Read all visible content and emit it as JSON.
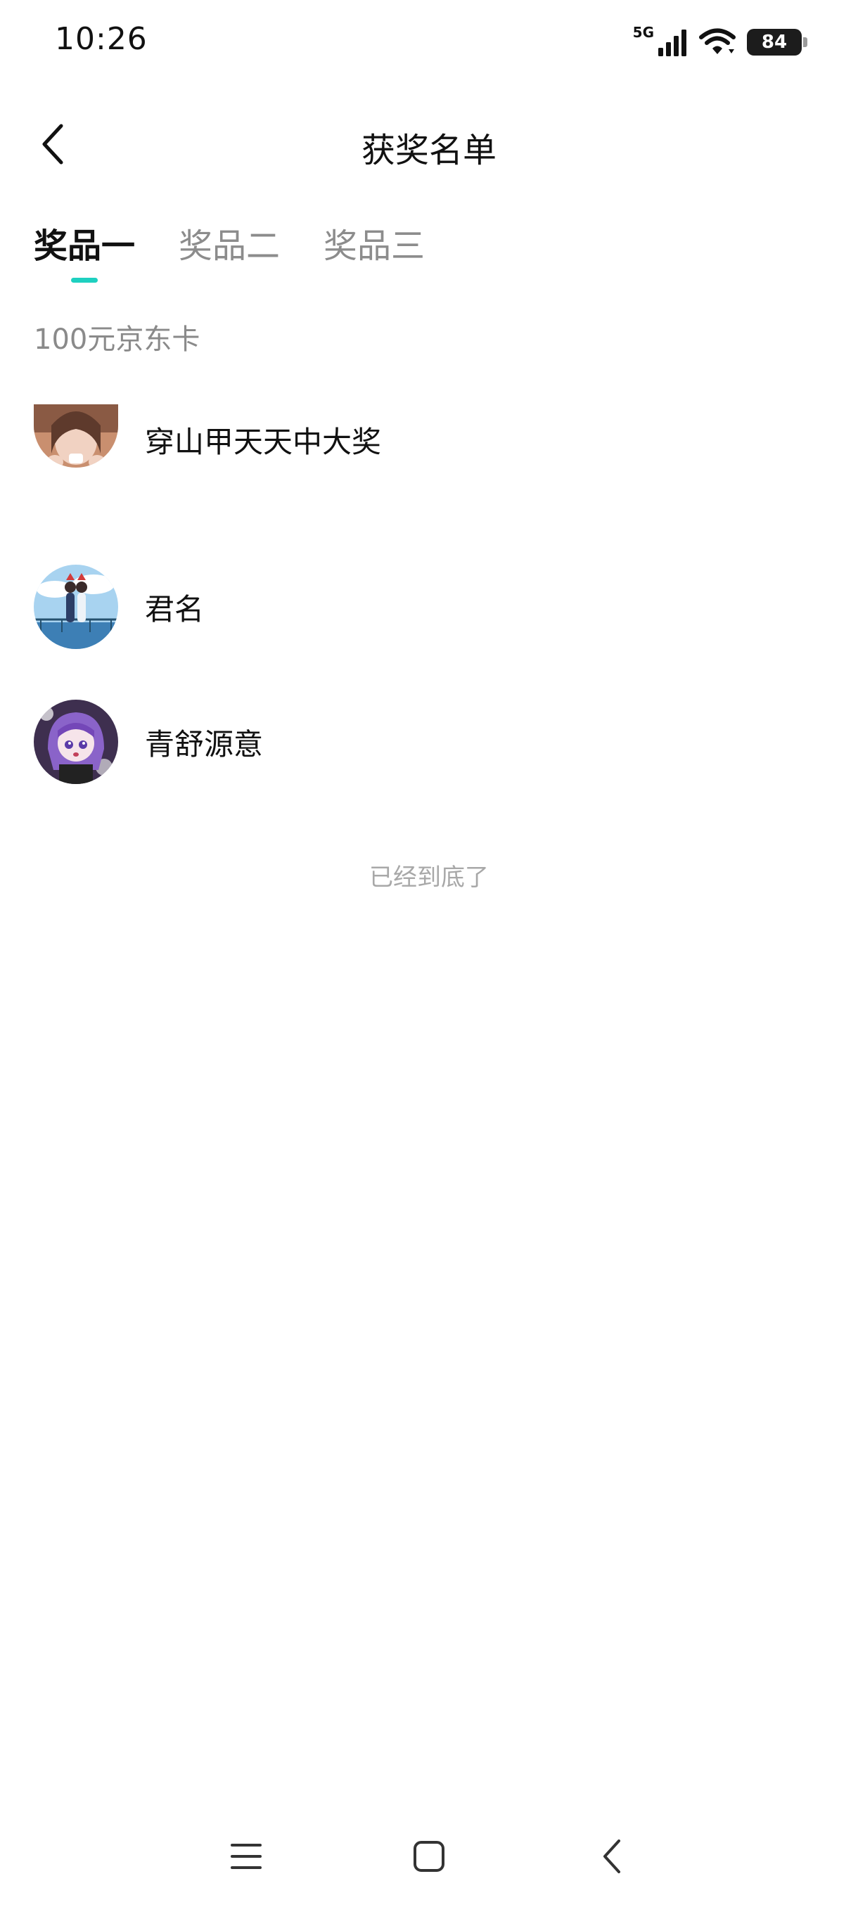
{
  "status_bar": {
    "time": "10:26",
    "network": "5G",
    "battery": "84",
    "icons": [
      "signal-icon",
      "wifi-icon",
      "battery-icon"
    ]
  },
  "header": {
    "title": "获奖名单",
    "back_icon": "back-chevron-icon"
  },
  "tabs": [
    {
      "label": "奖品一",
      "active": true
    },
    {
      "label": "奖品二",
      "active": false
    },
    {
      "label": "奖品三",
      "active": false
    }
  ],
  "prize": {
    "name": "100元京东卡"
  },
  "winners": [
    {
      "name": "穿山甲天天中大奖",
      "avatar": "avatar-photo-girl"
    },
    {
      "name": "君名",
      "avatar": "avatar-anime-couple"
    },
    {
      "name": "青舒源意",
      "avatar": "avatar-anime-purple-hair"
    }
  ],
  "footer": {
    "end_text": "已经到底了"
  },
  "nav_bar": {
    "icons": [
      "menu-icon",
      "home-icon",
      "back-icon"
    ]
  },
  "colors": {
    "accent": "#1ed0c0",
    "text_primary": "#111111",
    "text_secondary": "#8c8c8c",
    "text_muted": "#a8a8a8"
  }
}
